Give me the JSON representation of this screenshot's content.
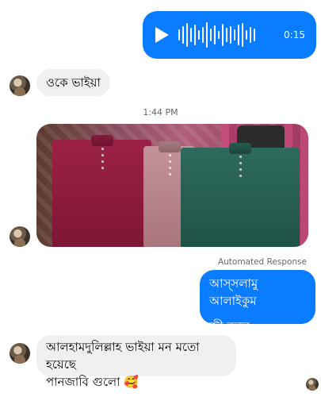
{
  "voice_message": {
    "duration": "0:15",
    "icon": "play-icon"
  },
  "messages": [
    {
      "text": "ওকে ভাইয়া"
    }
  ],
  "timestamp": "1:44 PM",
  "photo": {
    "icon": "photo-of-shirts"
  },
  "automated_label": "Automated Response",
  "auto_reply": {
    "line1": "আস্সলামু আলাইকুম",
    "line2": "জী বলুন"
  },
  "last_message": {
    "line1": "আলহামদুলিল্লাহ ভাইয়া মন মতো হয়েছে",
    "line2": "পানজাবি গুলো 🥰"
  },
  "colors": {
    "accent": "#0a7cff",
    "incoming_bubble": "#f0f0f0",
    "meta_text": "#65676b"
  }
}
